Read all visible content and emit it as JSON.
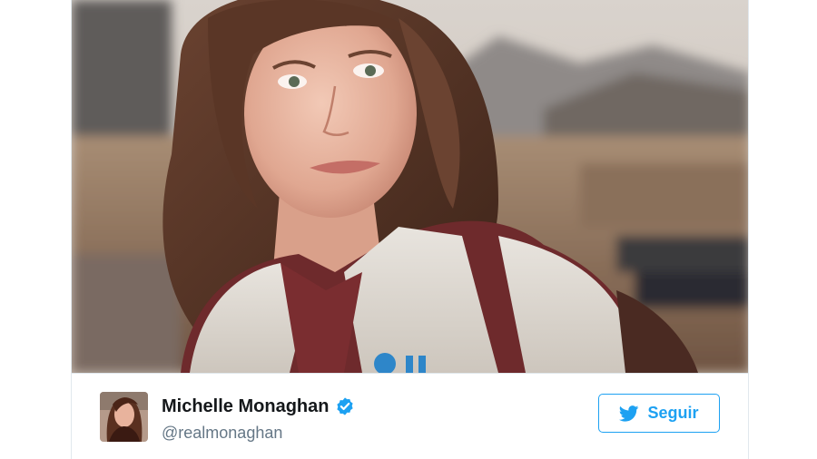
{
  "tweet": {
    "photo_icon": "selfie-photo",
    "author": {
      "display_name": "Michelle Monaghan",
      "handle": "@realmonaghan",
      "verified": true,
      "verified_icon": "verified-badge-icon",
      "avatar_icon": "profile-avatar"
    },
    "follow_button": {
      "label": "Seguir",
      "icon": "twitter-bird-icon"
    }
  },
  "colors": {
    "accent": "#1da1f2",
    "name_text": "#14171a",
    "handle_text": "#657786",
    "divider": "#e1e8ed"
  }
}
